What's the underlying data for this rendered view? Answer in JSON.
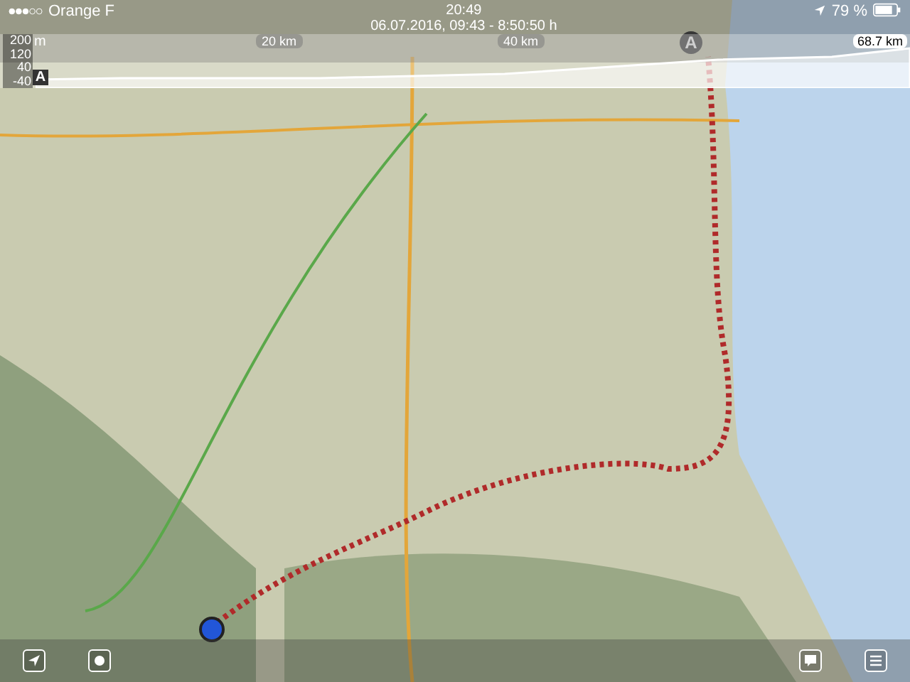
{
  "status_bar": {
    "carrier": "Orange F",
    "time": "20:49",
    "battery": "79 %"
  },
  "track_summary": "06.07.2016, 09:43 - 8:50:50 h",
  "elevation_profile": {
    "y_labels": [
      "200",
      "120",
      "40",
      "-40"
    ],
    "unit": "m",
    "distance_labels": [
      "20 km",
      "40 km"
    ],
    "total_distance": "68.7 km",
    "start_marker": "A"
  },
  "map": {
    "start_marker": "A"
  },
  "toolbar": {
    "left": [
      {
        "kind": "locate"
      },
      {
        "kind": "record"
      }
    ],
    "right": [
      {
        "kind": "message"
      },
      {
        "kind": "list"
      }
    ]
  }
}
